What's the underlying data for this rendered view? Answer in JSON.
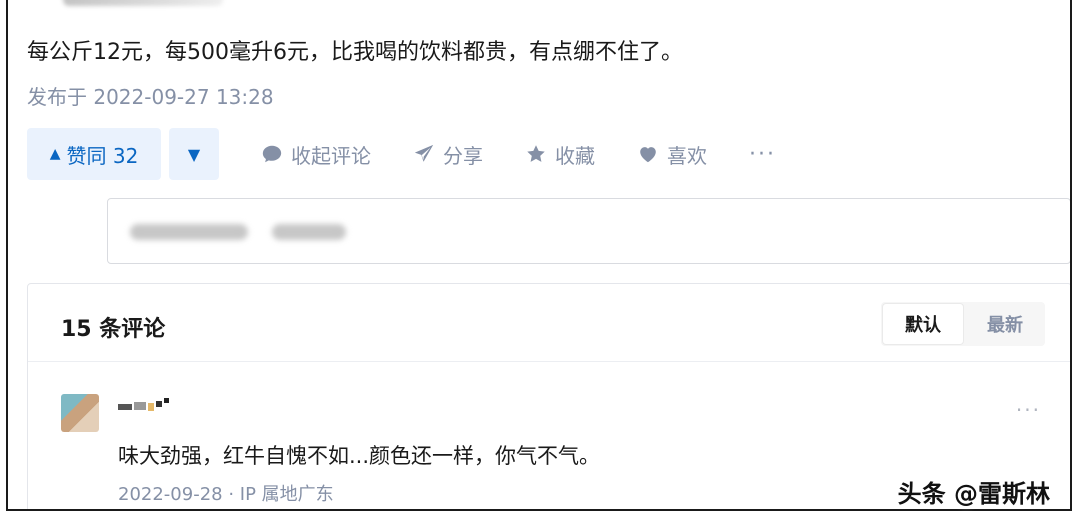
{
  "answer": {
    "text": "每公斤12元，每500毫升6元，比我喝的饮料都贵，有点绷不住了。",
    "published": "发布于 2022-09-27 13:28"
  },
  "actions": {
    "upvote_label": "赞同 32",
    "upvote_arrow": "▲",
    "downvote_arrow": "▼",
    "collapse_comments": "收起评论",
    "share": "分享",
    "favorite": "收藏",
    "like": "喜欢",
    "more": "···"
  },
  "comments": {
    "count_label": "15 条评论",
    "sort_options": [
      "默认",
      "最新"
    ],
    "sort_selected": "默认",
    "items": [
      {
        "text": "味大劲强，红牛自愧不如...颜色还一样，你气不气。",
        "meta": "2022-09-28 · IP 属地广东",
        "more": "···"
      }
    ]
  },
  "watermark": "头条 @雷斯林",
  "colors": {
    "accent": "#0a66c2",
    "accent_bg": "#eaf2fd",
    "muted": "#8590a6"
  }
}
